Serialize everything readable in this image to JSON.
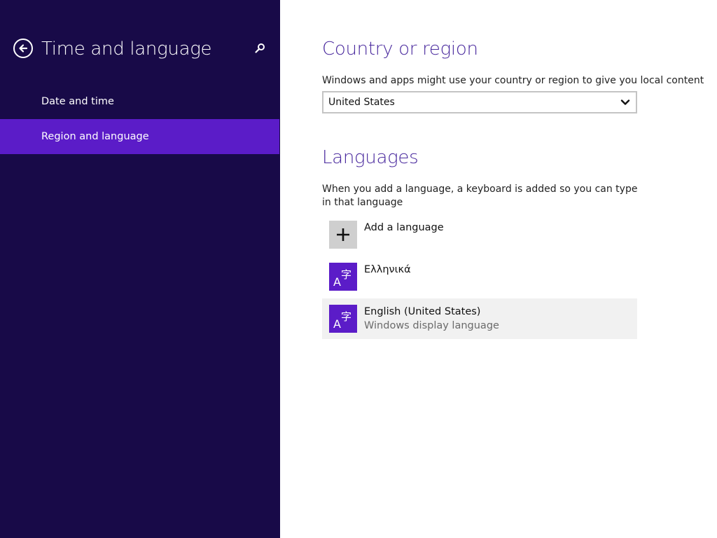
{
  "colors": {
    "sidebar_background": "#180a48",
    "accent": "#5b1cc8",
    "heading": "#4a2a9e",
    "selected_item_background": "#f1f1f1",
    "add_tile": "#cfcfcf"
  },
  "sidebar": {
    "title": "Time and language",
    "back_icon": "back-arrow-circle-icon",
    "search_icon": "search-icon",
    "items": [
      {
        "label": "Date and time",
        "selected": false
      },
      {
        "label": "Region and language",
        "selected": true
      }
    ]
  },
  "country": {
    "title": "Country or region",
    "description": "Windows and apps might use your country or region to give you local content",
    "selected": "United States"
  },
  "languages": {
    "title": "Languages",
    "description": "When you add a language, a keyboard is added so you can type in that language",
    "add_label": "Add a language",
    "items": [
      {
        "name": "Ελληνικά",
        "subtitle": "",
        "icon": "language-icon",
        "selected": false
      },
      {
        "name": "English (United States)",
        "subtitle": "Windows display language",
        "icon": "language-icon",
        "selected": true
      }
    ]
  }
}
